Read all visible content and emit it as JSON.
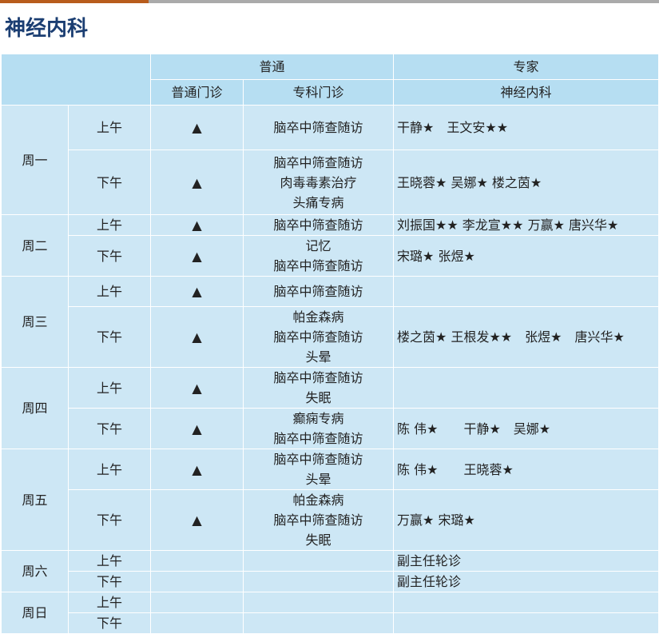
{
  "page_title": "神经内科",
  "header": {
    "group_general": "普通",
    "group_expert": "专家",
    "col_general_clinic": "普通门诊",
    "col_special_clinic": "专科门诊",
    "col_expert_dept": "神经内科"
  },
  "days": [
    {
      "day": "周一",
      "sessions": [
        {
          "period": "上午",
          "general": "▲",
          "special": [
            "脑卒中筛查随访"
          ],
          "expert": "干静★　王文安★★"
        },
        {
          "period": "下午",
          "general": "▲",
          "special": [
            "脑卒中筛查随访",
            "肉毒毒素治疗",
            "头痛专病"
          ],
          "expert": "王晓蓉★ 吴娜★ 楼之茵★"
        }
      ]
    },
    {
      "day": "周二",
      "sessions": [
        {
          "period": "上午",
          "general": "▲",
          "special": [
            "脑卒中筛查随访"
          ],
          "expert": "刘振国★★ 李龙宣★★ 万赢★ 唐兴华★"
        },
        {
          "period": "下午",
          "general": "▲",
          "special": [
            "记忆",
            "脑卒中筛查随访"
          ],
          "expert": "宋璐★ 张煜★"
        }
      ]
    },
    {
      "day": "周三",
      "sessions": [
        {
          "period": "上午",
          "general": "▲",
          "special": [
            "脑卒中筛查随访"
          ],
          "expert": ""
        },
        {
          "period": "下午",
          "general": "▲",
          "special": [
            "帕金森病",
            "脑卒中筛查随访",
            "头晕"
          ],
          "expert": "楼之茵★ 王根发★★　张煜★　唐兴华★"
        }
      ]
    },
    {
      "day": "周四",
      "sessions": [
        {
          "period": "上午",
          "general": "▲",
          "special": [
            "脑卒中筛查随访",
            "失眠"
          ],
          "expert": ""
        },
        {
          "period": "下午",
          "general": "▲",
          "special": [
            "癫痫专病",
            "脑卒中筛查随访"
          ],
          "expert": "陈 伟★　　干静★　吴娜★"
        }
      ]
    },
    {
      "day": "周五",
      "sessions": [
        {
          "period": "上午",
          "general": "▲",
          "special": [
            "脑卒中筛查随访",
            "头晕"
          ],
          "expert": "陈 伟★　　王晓蓉★"
        },
        {
          "period": "下午",
          "general": "▲",
          "special": [
            "帕金森病",
            "脑卒中筛查随访",
            "失眠"
          ],
          "expert": "万赢★ 宋璐★"
        }
      ]
    },
    {
      "day": "周六",
      "sessions": [
        {
          "period": "上午",
          "general": "",
          "special": [],
          "expert": "副主任轮诊"
        },
        {
          "period": "下午",
          "general": "",
          "special": [],
          "expert": "副主任轮诊"
        }
      ]
    },
    {
      "day": "周日",
      "sessions": [
        {
          "period": "上午",
          "general": "",
          "special": [],
          "expert": ""
        },
        {
          "period": "下午",
          "general": "",
          "special": [],
          "expert": ""
        }
      ]
    }
  ]
}
